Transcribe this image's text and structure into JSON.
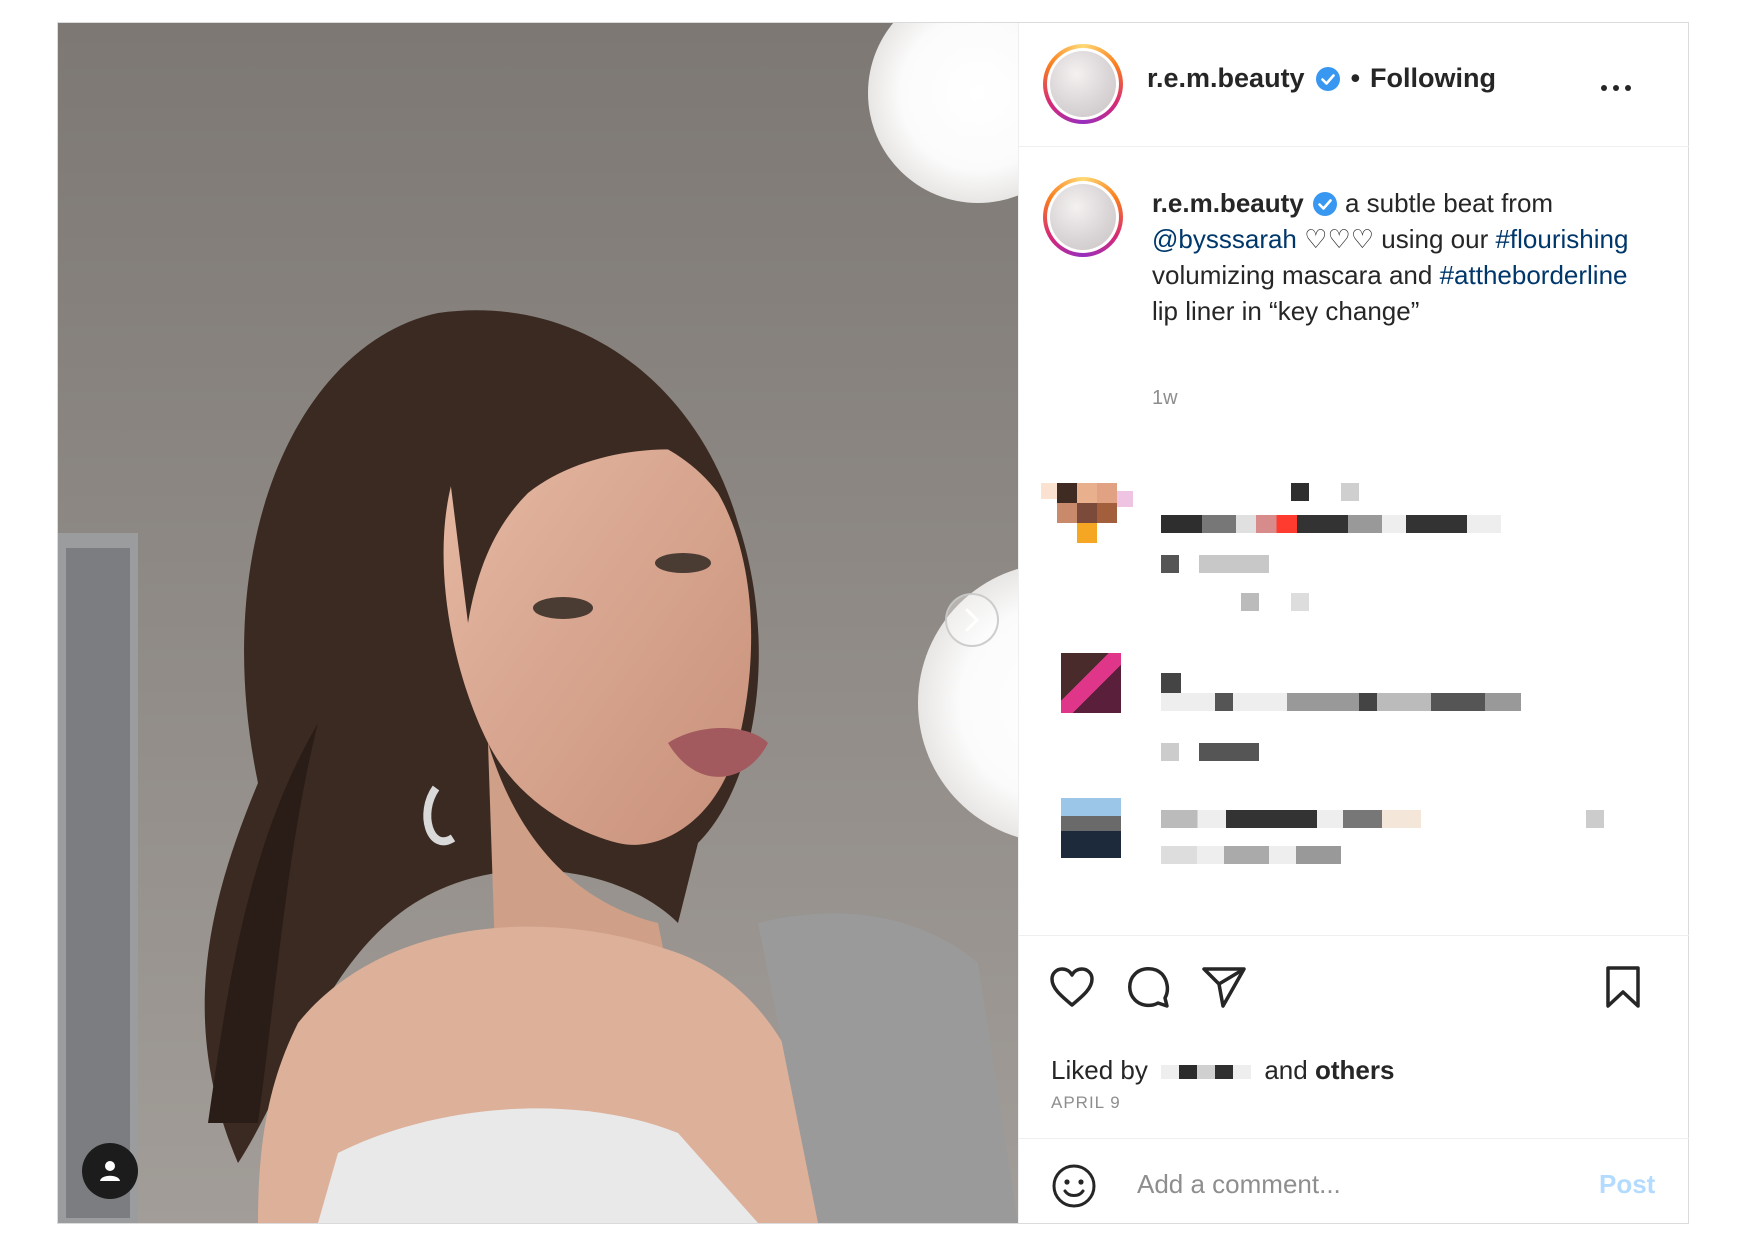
{
  "post": {
    "username": "r.e.m.beauty",
    "separator": "•",
    "follow_status": "Following",
    "caption_parts": {
      "user": "r.e.m.beauty",
      "text1": " a subtle beat from ",
      "mention": "@bysssarah",
      "text2": " ♡♡♡ using our ",
      "hashtag1": "#flourishing",
      "text3": " volumizing mascara and ",
      "hashtag2": "#attheborderline",
      "text4": " lip liner in “key change”"
    },
    "time_ago": "1w",
    "liked_prefix": "Liked by",
    "liked_suffix": "and",
    "liked_others": "others",
    "date": "APRIL 9",
    "comment_placeholder": "Add a comment...",
    "post_label": "Post"
  },
  "icons": {
    "like": "heart-icon",
    "comment": "comment-icon",
    "share": "send-icon",
    "save": "bookmark-icon",
    "emoji": "emoji-icon",
    "more": "more-icon",
    "next": "chevron-right-icon",
    "tags": "user-tag-icon",
    "verified": "verified-badge-icon"
  },
  "colors": {
    "verified_blue": "#3897f0",
    "link": "#00376b",
    "post_disabled": "#b3dbff",
    "muted": "#8e8e8e"
  }
}
